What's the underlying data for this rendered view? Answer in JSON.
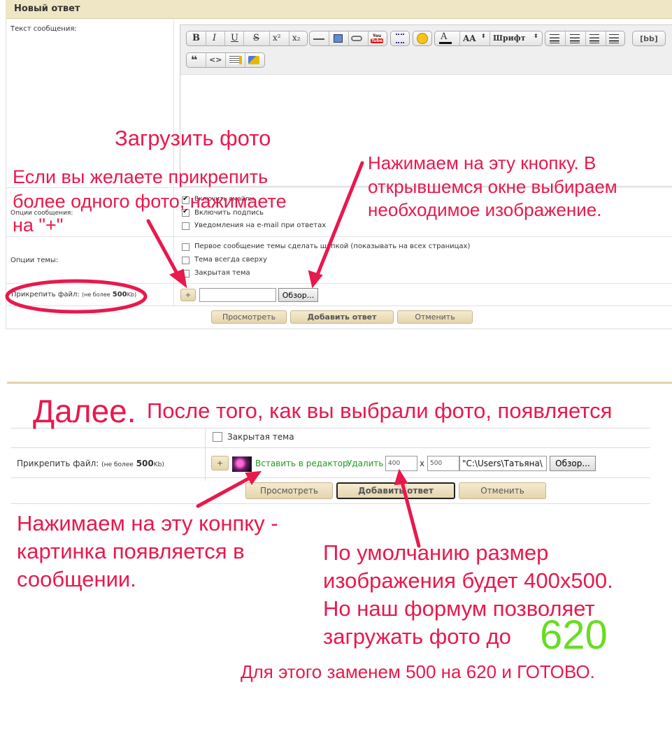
{
  "form1": {
    "header_title": "Новый ответ",
    "message_label": "Текст сообщения:",
    "toolbar": {
      "bold": "B",
      "italic": "I",
      "underline": "U",
      "strike": "S",
      "sup": "x²",
      "sub": "x₂",
      "youtube": "You Tube",
      "font_size": "AA",
      "font": "Шрифт",
      "bb": "[bb]"
    },
    "options_label": "Опции сообщения:",
    "options": [
      "Включить смайлы",
      "Включить подпись",
      "Уведомления на e-mail при ответах"
    ],
    "topic_label": "Опции темы:",
    "topic_options": [
      "Первое сообщение темы сделать шапкой (показывать на всех страницах)",
      "Тема всегда сверху",
      "Закрытая тема"
    ],
    "attach_label": "Прикрепить файл:",
    "attach_note": "(не более",
    "attach_size": "500",
    "attach_unit": "Kb)",
    "plus": "+",
    "browse": "Обзор...",
    "preview": "Просмотреть",
    "add_reply": "Добавить ответ",
    "cancel": "Отменить"
  },
  "form2": {
    "closed_topic": "Закрытая тема",
    "attach_label": "Прикрепить файл:",
    "attach_note": "(не более",
    "attach_size": "500",
    "attach_unit": "Kb)",
    "plus": "+",
    "insert": "Вставить в редактор",
    "delete": "Удалить",
    "width": "400",
    "x": "x",
    "height": "500",
    "path": "\"C:\\Users\\Татьяна\\",
    "browse": "Обзор...",
    "preview": "Просмотреть",
    "add_reply": "Добавить ответ",
    "cancel": "Отменить"
  },
  "annotations": {
    "upload_photo": "Загрузить фото",
    "more_files_1": "Если вы желаете прикрепить",
    "more_files_2": "более одного фото, нажимаете",
    "more_files_3": "на \"+\"",
    "press_1": "Нажимаем на эту кнопку. В",
    "press_2": "открывшемся окне выбираем",
    "press_3": "необходимое изображение.",
    "next": "Далее.",
    "after": "После того, как вы выбрали фото, появляется",
    "insert_1": "Нажимаем на эту конпку -",
    "insert_2": "картинка появляется в",
    "insert_3": "сообщении.",
    "size_1": "По умолчанию размер",
    "size_2": "изображения будет 400х500.",
    "size_3": "Но наш формум позволяет",
    "size_4": "загружать фото до",
    "size_620": "620",
    "final": "Для этого заменем 500 на 620 и ГОТОВО."
  },
  "colors": {
    "annotation": "#e8194d",
    "highlight_620": "#66dd22",
    "header_bg": "#efe6c6"
  }
}
